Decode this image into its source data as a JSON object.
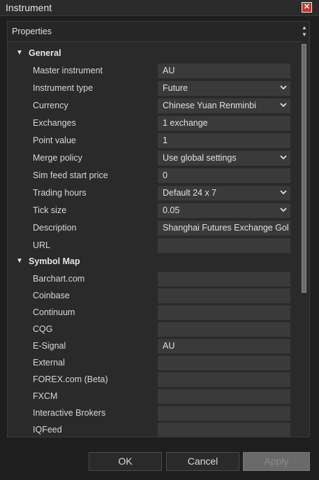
{
  "window": {
    "title": "Instrument",
    "close_glyph": "✕"
  },
  "panel": {
    "title": "Properties"
  },
  "sections": [
    {
      "label": "General",
      "rows": [
        {
          "label": "Master instrument",
          "value": "AU",
          "dropdown": false
        },
        {
          "label": "Instrument type",
          "value": "Future",
          "dropdown": true
        },
        {
          "label": "Currency",
          "value": "Chinese Yuan Renminbi",
          "dropdown": true
        },
        {
          "label": "Exchanges",
          "value": "1 exchange",
          "dropdown": false
        },
        {
          "label": "Point value",
          "value": "1",
          "dropdown": false
        },
        {
          "label": "Merge policy",
          "value": "Use global settings",
          "dropdown": true
        },
        {
          "label": "Sim feed start price",
          "value": "0",
          "dropdown": false
        },
        {
          "label": "Trading hours",
          "value": "Default 24 x 7",
          "dropdown": true
        },
        {
          "label": "Tick size",
          "value": "0.05",
          "dropdown": true
        },
        {
          "label": "Description",
          "value": "Shanghai Futures Exchange Gol",
          "dropdown": false
        },
        {
          "label": "URL",
          "value": "",
          "dropdown": false
        }
      ]
    },
    {
      "label": "Symbol Map",
      "rows": [
        {
          "label": "Barchart.com",
          "value": ""
        },
        {
          "label": "Coinbase",
          "value": ""
        },
        {
          "label": "Continuum",
          "value": ""
        },
        {
          "label": "CQG",
          "value": ""
        },
        {
          "label": "E-Signal",
          "value": "AU"
        },
        {
          "label": "External",
          "value": ""
        },
        {
          "label": "FOREX.com (Beta)",
          "value": ""
        },
        {
          "label": "FXCM",
          "value": ""
        },
        {
          "label": "Interactive Brokers",
          "value": ""
        },
        {
          "label": "IQFeed",
          "value": ""
        }
      ]
    }
  ],
  "buttons": {
    "ok": "OK",
    "cancel": "Cancel",
    "apply": "Apply"
  },
  "colors": {
    "close_button": "#c0392b",
    "input_bg": "#3a3a3a",
    "panel_bg": "#2a2a2a"
  }
}
